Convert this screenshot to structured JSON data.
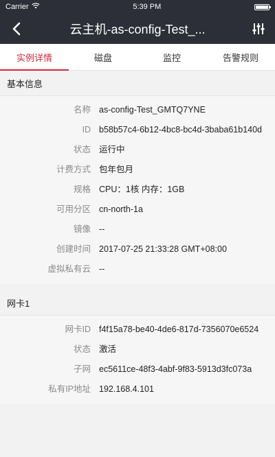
{
  "status_bar": {
    "carrier": "Carrier",
    "time": "5:39 PM"
  },
  "navbar": {
    "title": "云主机-as-config-Test_..."
  },
  "tabs": [
    {
      "label": "实例详情"
    },
    {
      "label": "磁盘"
    },
    {
      "label": "监控"
    },
    {
      "label": "告警规则"
    }
  ],
  "basic": {
    "header": "基本信息",
    "rows": [
      {
        "label": "名称",
        "value": "as-config-Test_GMTQ7YNE"
      },
      {
        "label": "ID",
        "value": "b58b57c4-6b12-4bc8-bc4d-3baba61b140d"
      },
      {
        "label": "状态",
        "value": "运行中"
      },
      {
        "label": "计费方式",
        "value": "包年包月"
      },
      {
        "label": "规格",
        "value": "CPU：1核   内存：1GB"
      },
      {
        "label": "可用分区",
        "value": "cn-north-1a"
      },
      {
        "label": "镜像",
        "value": "--"
      },
      {
        "label": "创建时间",
        "value": "2017-07-25 21:33:28 GMT+08:00"
      },
      {
        "label": "虚拟私有云",
        "value": "--"
      }
    ]
  },
  "nic": {
    "header": "网卡1",
    "rows": [
      {
        "label": "网卡ID",
        "value": "f4f15a78-be40-4de6-817d-7356070e6524"
      },
      {
        "label": "状态",
        "value": "激活"
      },
      {
        "label": "子网",
        "value": "ec5611ce-48f3-4abf-9f83-5913d3fc073a"
      },
      {
        "label": "私有IP地址",
        "value": "192.168.4.101"
      }
    ]
  }
}
